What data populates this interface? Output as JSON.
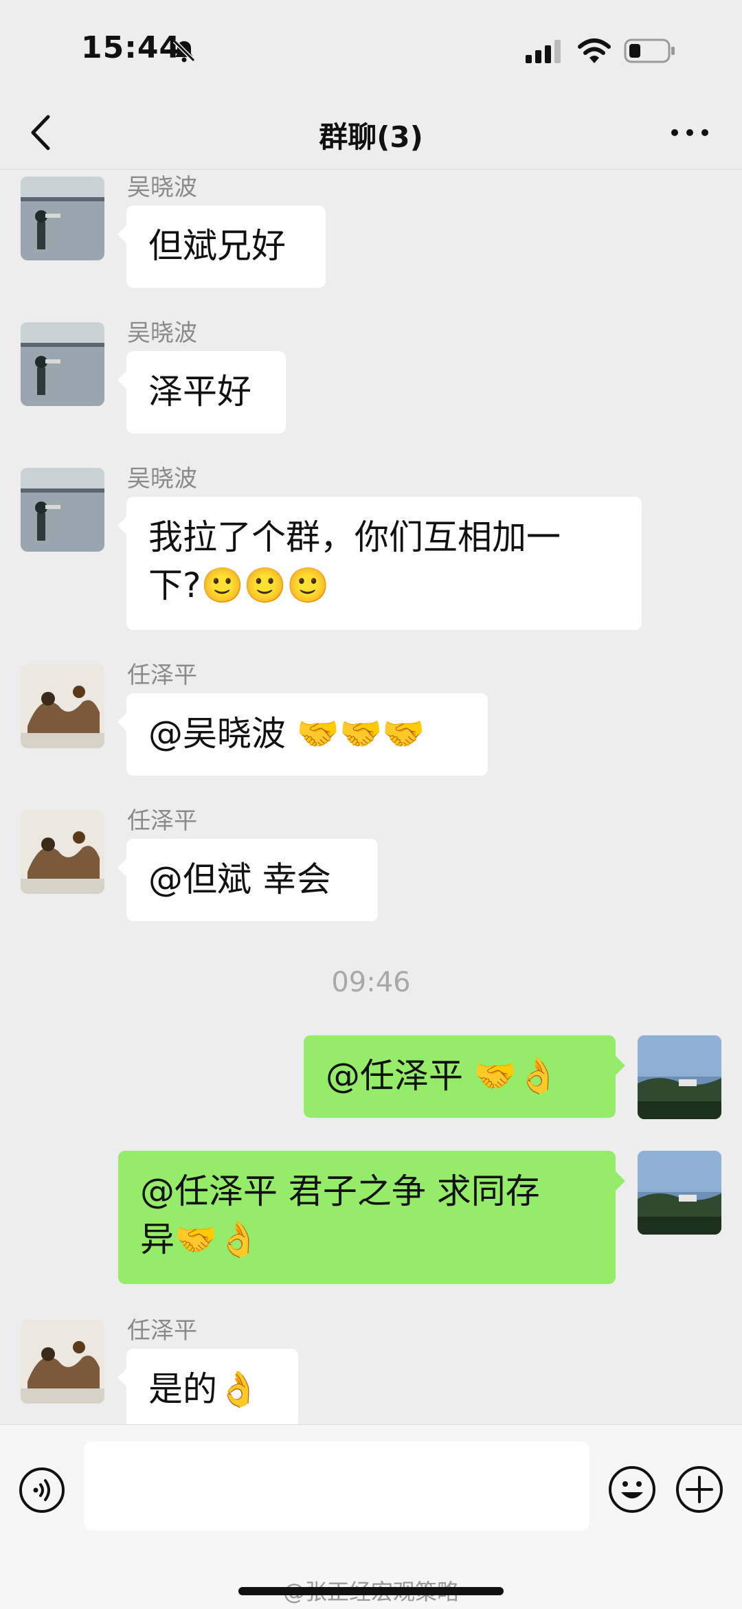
{
  "status": {
    "time": "15:44"
  },
  "nav": {
    "title": "群聊(3)"
  },
  "messages": [
    {
      "sender": "吴晓波",
      "text": "但斌兄好"
    },
    {
      "sender": "吴晓波",
      "text": "泽平好"
    },
    {
      "sender": "吴晓波",
      "line1": "我拉了个群，你们互相加一",
      "line2": "下?",
      "emoji": "🙂🙂🙂"
    },
    {
      "sender": "任泽平",
      "text": "@吴晓波 ",
      "emoji": "🤝🤝🤝"
    },
    {
      "sender": "任泽平",
      "text": "@但斌 幸会"
    },
    {
      "timestamp": "09:46"
    },
    {
      "sender": "me",
      "text": "@任泽平 ",
      "emoji": "🤝👌"
    },
    {
      "sender": "me",
      "line1": "@任泽平 君子之争 求同存",
      "line2": "异",
      "emoji": "🤝👌"
    },
    {
      "sender": "任泽平",
      "text": "是的",
      "emoji": "👌"
    }
  ],
  "input": {
    "placeholder": ""
  },
  "watermark": "@张正经宏观策略",
  "icons": {
    "mute": "bell-slash-icon",
    "signal": "cellular-signal-icon",
    "wifi": "wifi-icon",
    "battery": "battery-icon",
    "back": "chevron-left-icon",
    "more": "more-dots-icon",
    "voice": "voice-input-icon",
    "emoji": "emoji-icon",
    "plus": "plus-icon"
  }
}
